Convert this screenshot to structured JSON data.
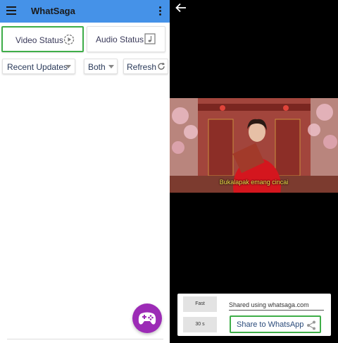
{
  "app": {
    "title": "WhatSaga"
  },
  "tabs": {
    "video_label": "Video Status",
    "audio_label": "Audio Status"
  },
  "filters": {
    "recent_label": "Recent Updates",
    "both_label": "Both",
    "refresh_label": "Refresh"
  },
  "player": {
    "subtitle": "Bukalapak emang cincai"
  },
  "share_panel": {
    "speed_fast_label": "Fast",
    "duration_label": "30 s",
    "caption_value": "Shared using whatsaga.com",
    "share_label": "Share to WhatsApp"
  },
  "colors": {
    "appbar": "#4592e8",
    "highlight": "#3fae49",
    "fab": "#9c2bb6"
  },
  "icons": [
    "menu-icon",
    "more-vert-icon",
    "play-circle-icon",
    "music-note-icon",
    "refresh-icon",
    "gamepad-icon",
    "arrow-back-icon",
    "share-icon"
  ]
}
